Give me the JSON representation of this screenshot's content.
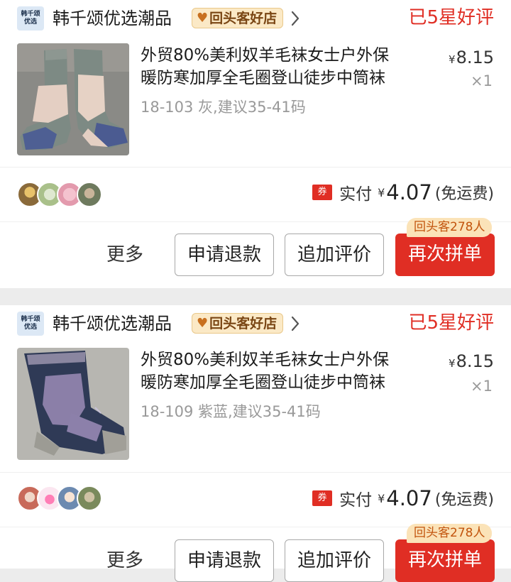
{
  "orders": [
    {
      "store": {
        "logo_text_1": "韩千颂",
        "logo_text_2": "优选",
        "name": "韩千颂优选潮品",
        "badge": "回头客好店"
      },
      "status": "已5星好评",
      "product": {
        "title_line1": "外贸80%美利奴羊毛袜女士户外保",
        "title_line2": "暖防寒加厚全毛圈登山徒步中筒袜",
        "spec": "18-103 灰,建议35-41码",
        "currency": "¥",
        "price": "8.15",
        "quantity": "×1"
      },
      "payment": {
        "coupon_tag": "券",
        "label": "实付",
        "currency": "¥",
        "amount": "4.07",
        "note": "(免运费)"
      },
      "actions": {
        "more": "更多",
        "refund": "申请退款",
        "review": "追加评价",
        "reorder": "再次拼单",
        "repeat_customers": "回头客278人"
      }
    },
    {
      "store": {
        "logo_text_1": "韩千颂",
        "logo_text_2": "优选",
        "name": "韩千颂优选潮品",
        "badge": "回头客好店"
      },
      "status": "已5星好评",
      "product": {
        "title_line1": "外贸80%美利奴羊毛袜女士户外保",
        "title_line2": "暖防寒加厚全毛圈登山徒步中筒袜",
        "spec": "18-109 紫蓝,建议35-41码",
        "currency": "¥",
        "price": "8.15",
        "quantity": "×1"
      },
      "payment": {
        "coupon_tag": "券",
        "label": "实付",
        "currency": "¥",
        "amount": "4.07",
        "note": "(免运费)"
      },
      "actions": {
        "more": "更多",
        "refund": "申请退款",
        "review": "追加评价",
        "reorder": "再次拼单",
        "repeat_customers": "回头客278人"
      }
    }
  ],
  "colors": {
    "accent_red": "#e02e24",
    "badge_bg": "#fbe9c6",
    "muted_text": "#999999"
  }
}
